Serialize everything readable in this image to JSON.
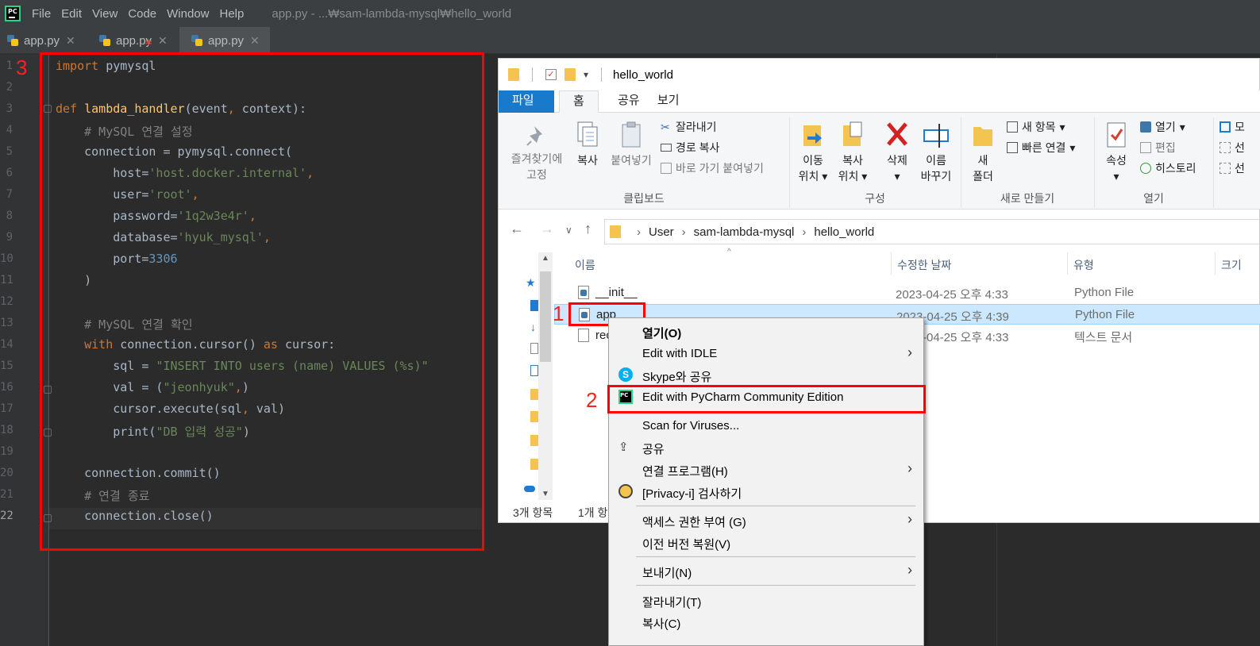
{
  "app": {
    "menu": [
      "File",
      "Edit",
      "View",
      "Code",
      "Window",
      "Help"
    ],
    "title": "app.py - ...₩sam-lambda-mysql₩hello_world"
  },
  "tabs": [
    {
      "label": "app.py",
      "active": false
    },
    {
      "label": "app.py",
      "active": false
    },
    {
      "label": "app.py",
      "active": true
    }
  ],
  "editor": {
    "line_numbers": [
      "1",
      "2",
      "3",
      "4",
      "5",
      "6",
      "7",
      "8",
      "9",
      "10",
      "11",
      "12",
      "13",
      "14",
      "15",
      "16",
      "17",
      "18",
      "19",
      "20",
      "21",
      "22"
    ],
    "current_line": "22"
  },
  "annotations": {
    "step1": "1",
    "step2": "2",
    "step3": "3",
    "box_color": "#ff0000"
  },
  "explorer": {
    "title": "hello_world",
    "ribbon_tabs": [
      "파일",
      "홈",
      "공유",
      "보기"
    ],
    "clipboard": {
      "pin": [
        "즐겨찾기에",
        "고정"
      ],
      "copy": "복사",
      "paste": "붙여넣기",
      "cut": "잘라내기",
      "copy_path": "경로 복사",
      "paste_shortcut": "바로 가기 붙여넣기",
      "group": "클립보드"
    },
    "organize": {
      "move_to": [
        "이동",
        "위치"
      ],
      "copy_to": [
        "복사",
        "위치"
      ],
      "delete": "삭제",
      "rename": [
        "이름",
        "바꾸기"
      ],
      "group": "구성"
    },
    "new": {
      "new_folder": [
        "새",
        "폴더"
      ],
      "new_item": "새 항목",
      "easy_access": "빠른 연결",
      "group": "새로 만들기"
    },
    "open": {
      "properties": "속성",
      "open": "열기",
      "edit": "편집",
      "history": "히스토리",
      "group": "열기"
    },
    "select_partial": [
      "모",
      "선",
      "선"
    ],
    "breadcrumb": [
      "User",
      "sam-lambda-mysql",
      "hello_world"
    ],
    "columns": {
      "name": "이름",
      "modified": "수정한 날짜",
      "type": "유형",
      "size": "크기"
    },
    "files": [
      {
        "name": "__init__",
        "modified": "2023-04-25 오후 4:33",
        "type": "Python File"
      },
      {
        "name": "app",
        "modified": "2023-04-25 오후 4:39",
        "type": "Python File"
      },
      {
        "name": "rec",
        "modified": "-04-25 오후 4:33",
        "type": "텍스트 문서"
      }
    ],
    "status": {
      "count": "3개 항목",
      "selected": "1개 항"
    }
  },
  "context_menu": {
    "items": [
      {
        "label": "열기(O)"
      },
      {
        "label": "Edit with IDLE"
      },
      {
        "label": "Skype와 공유"
      },
      {
        "label": "Edit with PyCharm Community Edition"
      },
      {
        "label": "Scan for Viruses..."
      },
      {
        "label": "공유"
      },
      {
        "label": "연결 프로그램(H)"
      },
      {
        "label": "[Privacy-i] 검사하기"
      },
      {
        "label": "액세스 권한 부여 (G)"
      },
      {
        "label": "이전 버전 복원(V)"
      },
      {
        "label": "보내기(N)"
      },
      {
        "label": "잘라내기(T)"
      },
      {
        "label": "복사(C)"
      }
    ]
  }
}
